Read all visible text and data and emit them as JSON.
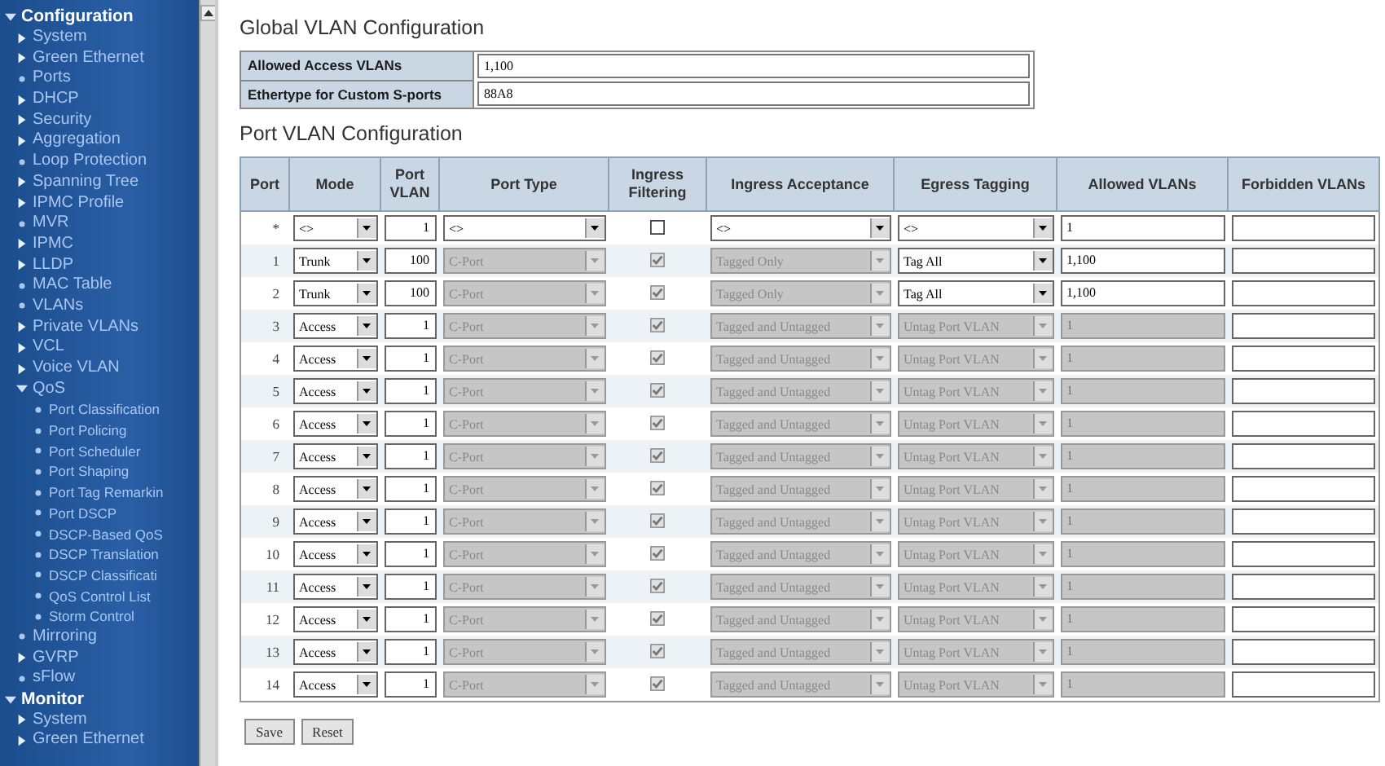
{
  "sidebar": {
    "items": [
      {
        "label": "Configuration",
        "kind": "section",
        "expanded": true,
        "children": [
          {
            "label": "System",
            "kind": "folder"
          },
          {
            "label": "Green Ethernet",
            "kind": "folder"
          },
          {
            "label": "Ports",
            "kind": "page"
          },
          {
            "label": "DHCP",
            "kind": "folder"
          },
          {
            "label": "Security",
            "kind": "folder"
          },
          {
            "label": "Aggregation",
            "kind": "folder"
          },
          {
            "label": "Loop Protection",
            "kind": "page"
          },
          {
            "label": "Spanning Tree",
            "kind": "folder"
          },
          {
            "label": "IPMC Profile",
            "kind": "folder"
          },
          {
            "label": "MVR",
            "kind": "page"
          },
          {
            "label": "IPMC",
            "kind": "folder"
          },
          {
            "label": "LLDP",
            "kind": "folder"
          },
          {
            "label": "MAC Table",
            "kind": "page"
          },
          {
            "label": "VLANs",
            "kind": "page"
          },
          {
            "label": "Private VLANs",
            "kind": "folder"
          },
          {
            "label": "VCL",
            "kind": "folder"
          },
          {
            "label": "Voice VLAN",
            "kind": "folder"
          },
          {
            "label": "QoS",
            "kind": "folder",
            "expanded": true,
            "children": [
              {
                "label": "Port Classification",
                "kind": "page"
              },
              {
                "label": "Port Policing",
                "kind": "page"
              },
              {
                "label": "Port Scheduler",
                "kind": "page"
              },
              {
                "label": "Port Shaping",
                "kind": "page"
              },
              {
                "label": "Port Tag Remarkin",
                "kind": "page"
              },
              {
                "label": "Port DSCP",
                "kind": "page"
              },
              {
                "label": "DSCP-Based QoS",
                "kind": "page"
              },
              {
                "label": "DSCP Translation",
                "kind": "page"
              },
              {
                "label": "DSCP Classificati",
                "kind": "page"
              },
              {
                "label": "QoS Control List",
                "kind": "page"
              },
              {
                "label": "Storm Control",
                "kind": "page"
              }
            ]
          },
          {
            "label": "Mirroring",
            "kind": "page"
          },
          {
            "label": "GVRP",
            "kind": "folder"
          },
          {
            "label": "sFlow",
            "kind": "page"
          }
        ]
      },
      {
        "label": "Monitor",
        "kind": "section",
        "expanded": true,
        "children": [
          {
            "label": "System",
            "kind": "folder"
          },
          {
            "label": "Green Ethernet",
            "kind": "folder"
          }
        ]
      }
    ]
  },
  "global_vlan_configuration": {
    "title": "Global VLAN Configuration",
    "fields": [
      {
        "label": "Allowed Access VLANs",
        "value": "1,100"
      },
      {
        "label": "Ethertype for Custom S-ports",
        "value": "88A8"
      }
    ]
  },
  "port_vlan_configuration": {
    "title": "Port VLAN Configuration",
    "columns": [
      "Port",
      "Mode",
      "Port VLAN",
      "Port Type",
      "Ingress Filtering",
      "Ingress Acceptance",
      "Egress Tagging",
      "Allowed VLANs",
      "Forbidden VLANs"
    ],
    "rows": [
      {
        "port": "*",
        "mode": "<>",
        "port_vlan": "1",
        "port_type": {
          "value": "<>",
          "disabled": false
        },
        "ingress_filtering": {
          "checked": false,
          "disabled": false
        },
        "ingress_acceptance": {
          "value": "<>",
          "disabled": false
        },
        "egress_tagging": {
          "value": "<>",
          "disabled": false
        },
        "allowed_vlans": {
          "value": "1",
          "disabled": false
        },
        "forbidden_vlans": {
          "disabled": false
        }
      },
      {
        "port": "1",
        "mode": "Trunk",
        "port_vlan": "100",
        "port_type": {
          "value": "C-Port",
          "disabled": true
        },
        "ingress_filtering": {
          "checked": true,
          "disabled": true
        },
        "ingress_acceptance": {
          "value": "Tagged Only",
          "disabled": true
        },
        "egress_tagging": {
          "value": "Tag All",
          "disabled": false
        },
        "allowed_vlans": {
          "value": "1,100",
          "disabled": false
        },
        "forbidden_vlans": {
          "disabled": false
        }
      },
      {
        "port": "2",
        "mode": "Trunk",
        "port_vlan": "100",
        "port_type": {
          "value": "C-Port",
          "disabled": true
        },
        "ingress_filtering": {
          "checked": true,
          "disabled": true
        },
        "ingress_acceptance": {
          "value": "Tagged Only",
          "disabled": true
        },
        "egress_tagging": {
          "value": "Tag All",
          "disabled": false
        },
        "allowed_vlans": {
          "value": "1,100",
          "disabled": false
        },
        "forbidden_vlans": {
          "disabled": false
        }
      },
      {
        "port": "3",
        "mode": "Access",
        "port_vlan": "1",
        "port_type": {
          "value": "C-Port",
          "disabled": true
        },
        "ingress_filtering": {
          "checked": true,
          "disabled": true
        },
        "ingress_acceptance": {
          "value": "Tagged and Untagged",
          "disabled": true
        },
        "egress_tagging": {
          "value": "Untag Port VLAN",
          "disabled": true
        },
        "allowed_vlans": {
          "value": "1",
          "disabled": true
        },
        "forbidden_vlans": {
          "disabled": false
        }
      },
      {
        "port": "4",
        "mode": "Access",
        "port_vlan": "1",
        "port_type": {
          "value": "C-Port",
          "disabled": true
        },
        "ingress_filtering": {
          "checked": true,
          "disabled": true
        },
        "ingress_acceptance": {
          "value": "Tagged and Untagged",
          "disabled": true
        },
        "egress_tagging": {
          "value": "Untag Port VLAN",
          "disabled": true
        },
        "allowed_vlans": {
          "value": "1",
          "disabled": true
        },
        "forbidden_vlans": {
          "disabled": false
        }
      },
      {
        "port": "5",
        "mode": "Access",
        "port_vlan": "1",
        "port_type": {
          "value": "C-Port",
          "disabled": true
        },
        "ingress_filtering": {
          "checked": true,
          "disabled": true
        },
        "ingress_acceptance": {
          "value": "Tagged and Untagged",
          "disabled": true
        },
        "egress_tagging": {
          "value": "Untag Port VLAN",
          "disabled": true
        },
        "allowed_vlans": {
          "value": "1",
          "disabled": true
        },
        "forbidden_vlans": {
          "disabled": false
        }
      },
      {
        "port": "6",
        "mode": "Access",
        "port_vlan": "1",
        "port_type": {
          "value": "C-Port",
          "disabled": true
        },
        "ingress_filtering": {
          "checked": true,
          "disabled": true
        },
        "ingress_acceptance": {
          "value": "Tagged and Untagged",
          "disabled": true
        },
        "egress_tagging": {
          "value": "Untag Port VLAN",
          "disabled": true
        },
        "allowed_vlans": {
          "value": "1",
          "disabled": true
        },
        "forbidden_vlans": {
          "disabled": false
        }
      },
      {
        "port": "7",
        "mode": "Access",
        "port_vlan": "1",
        "port_type": {
          "value": "C-Port",
          "disabled": true
        },
        "ingress_filtering": {
          "checked": true,
          "disabled": true
        },
        "ingress_acceptance": {
          "value": "Tagged and Untagged",
          "disabled": true
        },
        "egress_tagging": {
          "value": "Untag Port VLAN",
          "disabled": true
        },
        "allowed_vlans": {
          "value": "1",
          "disabled": true
        },
        "forbidden_vlans": {
          "disabled": false
        }
      },
      {
        "port": "8",
        "mode": "Access",
        "port_vlan": "1",
        "port_type": {
          "value": "C-Port",
          "disabled": true
        },
        "ingress_filtering": {
          "checked": true,
          "disabled": true
        },
        "ingress_acceptance": {
          "value": "Tagged and Untagged",
          "disabled": true
        },
        "egress_tagging": {
          "value": "Untag Port VLAN",
          "disabled": true
        },
        "allowed_vlans": {
          "value": "1",
          "disabled": true
        },
        "forbidden_vlans": {
          "disabled": false
        }
      },
      {
        "port": "9",
        "mode": "Access",
        "port_vlan": "1",
        "port_type": {
          "value": "C-Port",
          "disabled": true
        },
        "ingress_filtering": {
          "checked": true,
          "disabled": true
        },
        "ingress_acceptance": {
          "value": "Tagged and Untagged",
          "disabled": true
        },
        "egress_tagging": {
          "value": "Untag Port VLAN",
          "disabled": true
        },
        "allowed_vlans": {
          "value": "1",
          "disabled": true
        },
        "forbidden_vlans": {
          "disabled": false
        }
      },
      {
        "port": "10",
        "mode": "Access",
        "port_vlan": "1",
        "port_type": {
          "value": "C-Port",
          "disabled": true
        },
        "ingress_filtering": {
          "checked": true,
          "disabled": true
        },
        "ingress_acceptance": {
          "value": "Tagged and Untagged",
          "disabled": true
        },
        "egress_tagging": {
          "value": "Untag Port VLAN",
          "disabled": true
        },
        "allowed_vlans": {
          "value": "1",
          "disabled": true
        },
        "forbidden_vlans": {
          "disabled": false
        }
      },
      {
        "port": "11",
        "mode": "Access",
        "port_vlan": "1",
        "port_type": {
          "value": "C-Port",
          "disabled": true
        },
        "ingress_filtering": {
          "checked": true,
          "disabled": true
        },
        "ingress_acceptance": {
          "value": "Tagged and Untagged",
          "disabled": true
        },
        "egress_tagging": {
          "value": "Untag Port VLAN",
          "disabled": true
        },
        "allowed_vlans": {
          "value": "1",
          "disabled": true
        },
        "forbidden_vlans": {
          "disabled": false
        }
      },
      {
        "port": "12",
        "mode": "Access",
        "port_vlan": "1",
        "port_type": {
          "value": "C-Port",
          "disabled": true
        },
        "ingress_filtering": {
          "checked": true,
          "disabled": true
        },
        "ingress_acceptance": {
          "value": "Tagged and Untagged",
          "disabled": true
        },
        "egress_tagging": {
          "value": "Untag Port VLAN",
          "disabled": true
        },
        "allowed_vlans": {
          "value": "1",
          "disabled": true
        },
        "forbidden_vlans": {
          "disabled": false
        }
      },
      {
        "port": "13",
        "mode": "Access",
        "port_vlan": "1",
        "port_type": {
          "value": "C-Port",
          "disabled": true
        },
        "ingress_filtering": {
          "checked": true,
          "disabled": true
        },
        "ingress_acceptance": {
          "value": "Tagged and Untagged",
          "disabled": true
        },
        "egress_tagging": {
          "value": "Untag Port VLAN",
          "disabled": true
        },
        "allowed_vlans": {
          "value": "1",
          "disabled": true
        },
        "forbidden_vlans": {
          "disabled": false
        }
      },
      {
        "port": "14",
        "mode": "Access",
        "port_vlan": "1",
        "port_type": {
          "value": "C-Port",
          "disabled": true
        },
        "ingress_filtering": {
          "checked": true,
          "disabled": true
        },
        "ingress_acceptance": {
          "value": "Tagged and Untagged",
          "disabled": true
        },
        "egress_tagging": {
          "value": "Untag Port VLAN",
          "disabled": true
        },
        "allowed_vlans": {
          "value": "1",
          "disabled": true
        },
        "forbidden_vlans": {
          "disabled": false
        }
      }
    ]
  },
  "buttons": [
    "Save",
    "Reset"
  ]
}
